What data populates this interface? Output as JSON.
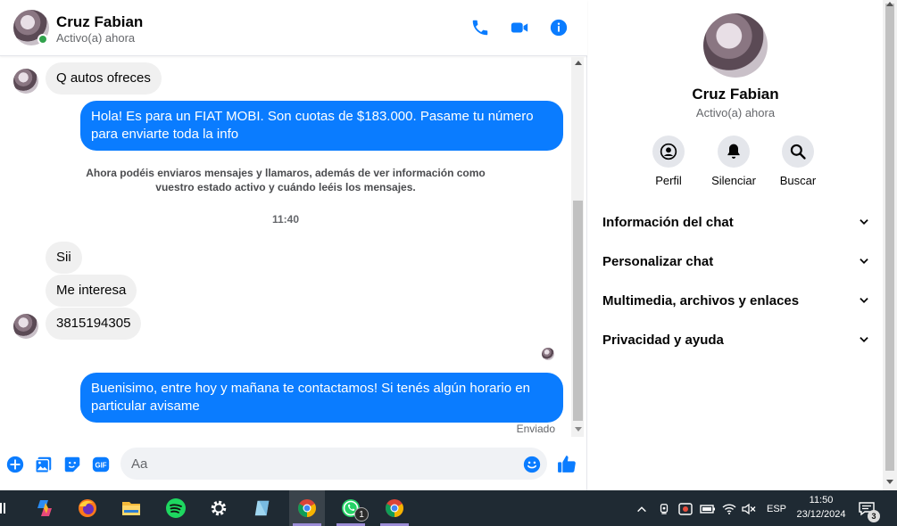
{
  "header": {
    "name": "Cruz Fabian",
    "status": "Activo(a) ahora"
  },
  "messages": [
    {
      "text": "Q autos ofreces"
    },
    {
      "text": "Hola! Es para un FIAT MOBI. Son cuotas de $183.000. Pasame tu número para enviarte toda la info"
    },
    {
      "text": "Ahora podéis enviaros mensajes y llamaros, además de ver información como vuestro estado activo y cuándo leéis los mensajes."
    },
    {
      "text": "11:40"
    },
    {
      "text": "Sii"
    },
    {
      "text": "Me interesa"
    },
    {
      "text": "3815194305"
    },
    {
      "text": "Buenisimo, entre hoy y mañana te contactamos! Si tenés algún horario en particular avisame"
    },
    {
      "text": "Enviado"
    }
  ],
  "composer": {
    "placeholder": "Aa"
  },
  "info_panel": {
    "name": "Cruz Fabian",
    "status": "Activo(a) ahora",
    "actions": [
      {
        "label": "Perfil",
        "icon": "profile-icon"
      },
      {
        "label": "Silenciar",
        "icon": "bell-icon"
      },
      {
        "label": "Buscar",
        "icon": "search-icon"
      }
    ],
    "sections": [
      {
        "label": "Información del chat"
      },
      {
        "label": "Personalizar chat"
      },
      {
        "label": "Multimedia, archivos y enlaces"
      },
      {
        "label": "Privacidad y ayuda"
      }
    ]
  },
  "taskbar": {
    "whatsapp_badge": "1",
    "language": "ESP",
    "time": "11:50",
    "date": "23/12/2024",
    "notification_count": "3"
  },
  "colors": {
    "accent": "#0a7cff",
    "incoming_bubble": "#f0f0f0",
    "online": "#31a24c",
    "taskbar": "#1f2a33"
  }
}
